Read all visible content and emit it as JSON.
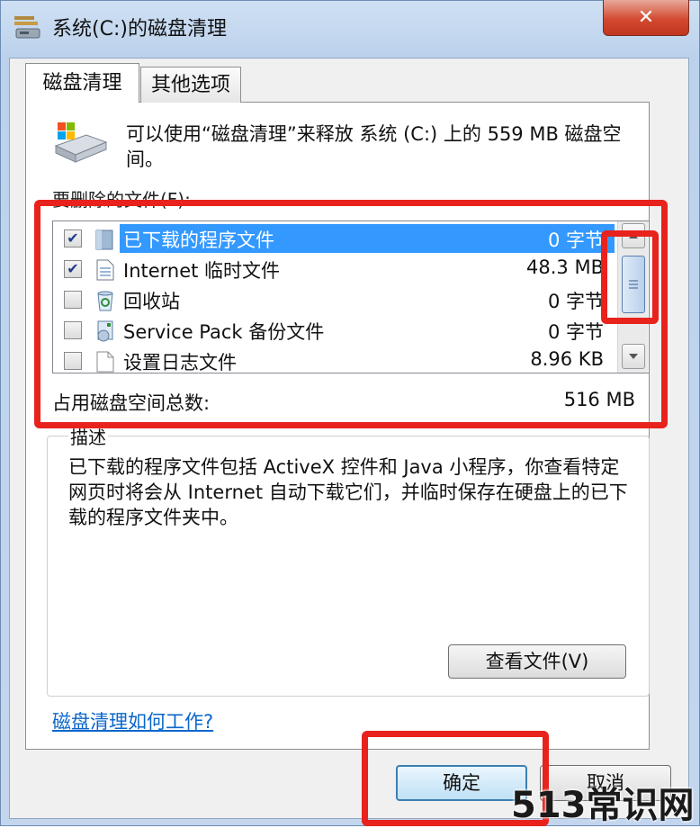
{
  "window": {
    "title": "系统(C:)的磁盘清理",
    "close_glyph": "✕"
  },
  "tabs": [
    {
      "label": "磁盘清理"
    },
    {
      "label": "其他选项"
    }
  ],
  "intro_text": "可以使用“磁盘清理”来释放 系统 (C:) 上的 559 MB 磁盘空间。",
  "files_label": "要删除的文件(F):",
  "files": [
    {
      "name": "已下载的程序文件",
      "size": "0 字节",
      "checked": true,
      "selected": true,
      "icon": "folder-icon"
    },
    {
      "name": "Internet 临时文件",
      "size": "48.3 MB",
      "checked": true,
      "selected": false,
      "icon": "document-icon"
    },
    {
      "name": "回收站",
      "size": "0 字节",
      "checked": false,
      "selected": false,
      "icon": "recycle-bin-icon"
    },
    {
      "name": "Service Pack 备份文件",
      "size": "0 字节",
      "checked": false,
      "selected": false,
      "icon": "installer-icon"
    },
    {
      "name": "设置日志文件",
      "size": "8.96 KB",
      "checked": false,
      "selected": false,
      "icon": "file-icon"
    }
  ],
  "check_glyph": "✔",
  "total": {
    "label": "占用磁盘空间总数:",
    "value": "516 MB"
  },
  "description": {
    "legend": "描述",
    "text": "已下载的程序文件包括 ActiveX 控件和 Java 小程序，你查看特定网页时将会从 Internet 自动下载它们，并临时保存在硬盘上的已下载的程序文件夹中。"
  },
  "buttons": {
    "view_files": "查看文件(V)",
    "ok": "确定",
    "cancel": "取消"
  },
  "help_link": "磁盘清理如何工作?",
  "watermark": "513常识网",
  "colors": {
    "selection": "#3399ff",
    "annotation_red": "#e8221c",
    "link": "#0a66cc"
  }
}
